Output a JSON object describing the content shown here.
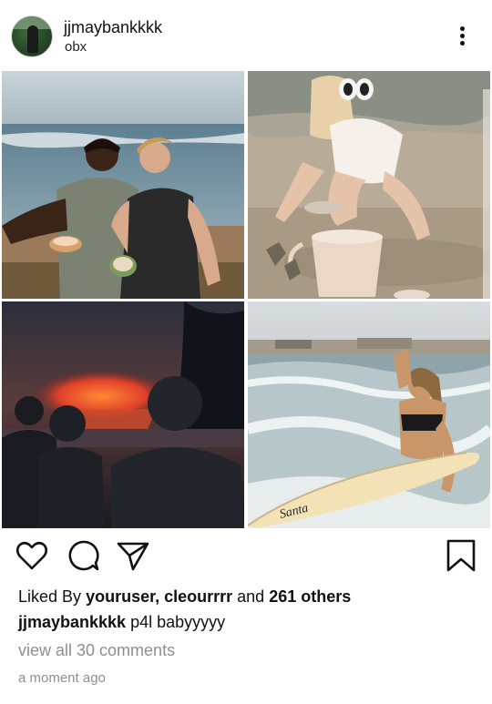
{
  "post": {
    "username": "jjmaybankkkk",
    "location": "obx",
    "likes": {
      "prefix": "Liked By",
      "users": "youruser, cleourrrr",
      "joiner": "and",
      "others": "261 others"
    },
    "caption": {
      "author": "jjmaybankkkk",
      "text": "p4l babyyyyy"
    },
    "comments_link": "view all 30 comments",
    "timestamp": "a moment ago"
  },
  "icons": {
    "more": "more-vertical-icon",
    "like": "heart-icon",
    "comment": "comment-bubble-icon",
    "share": "send-paper-plane-icon",
    "save": "bookmark-icon"
  },
  "colors": {
    "text": "#111111",
    "muted": "#8e8e8e",
    "background": "#ffffff"
  }
}
